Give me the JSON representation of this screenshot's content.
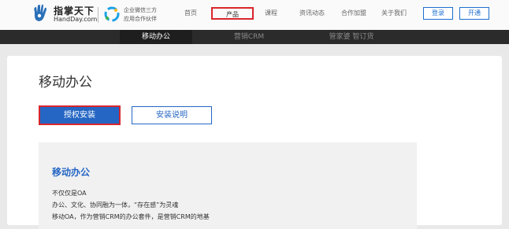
{
  "header": {
    "brand_cn": "指掌天下",
    "brand_domain": "HandDay.com",
    "partner_line1": "企业微信三方",
    "partner_line2": "应用合作伙伴",
    "nav": [
      {
        "label": "首页"
      },
      {
        "label": "产品"
      },
      {
        "label": "课程"
      },
      {
        "label": "资讯动态"
      },
      {
        "label": "合作加盟"
      },
      {
        "label": "关于我们"
      }
    ],
    "login_label": "登录",
    "open_label": "开通"
  },
  "subnav": {
    "items": [
      {
        "label": "移动办公"
      },
      {
        "label": "营销CRM"
      },
      {
        "label": "管家婆 智订货"
      }
    ]
  },
  "main": {
    "title": "移动办公",
    "install_button": "授权安装",
    "guide_button": "安装说明",
    "intro": {
      "heading": "移动办公",
      "line1": "不仅仅是OA",
      "line2": "办公、文化、协同融为一体，“存在感”为灵魂",
      "line3": "移动OA，作为营销CRM的办公套件，是营销CRM的地基"
    }
  },
  "colors": {
    "accent": "#2566c4",
    "highlight_border": "#d9262b",
    "subnav_bg": "#2b2b2b"
  }
}
